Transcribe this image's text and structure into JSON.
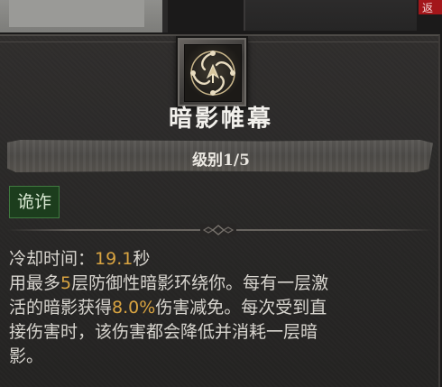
{
  "background": {
    "corner_badge": "返"
  },
  "skill": {
    "icon": "swirl-rune-icon",
    "title": "暗影帷幕",
    "rank": "级别1/5",
    "tag": "诡诈",
    "cooldown_label": "冷却时间：",
    "cooldown_value": "19.1",
    "cooldown_unit": "秒",
    "desc_1a": "用最多",
    "desc_1b": "5",
    "desc_1c": "层防御性暗影环绕你。每有一层激",
    "desc_2a": "活的暗影获得",
    "desc_2b": "8.0%",
    "desc_2c": "伤害减免。每次受到直",
    "desc_3": "接伤害时，该伤害都会降低并消耗一层暗",
    "desc_4": "影。"
  },
  "colors": {
    "highlight": "#d9a441",
    "tag_bg": "#1c3d1d",
    "text": "#d8d5cf"
  }
}
